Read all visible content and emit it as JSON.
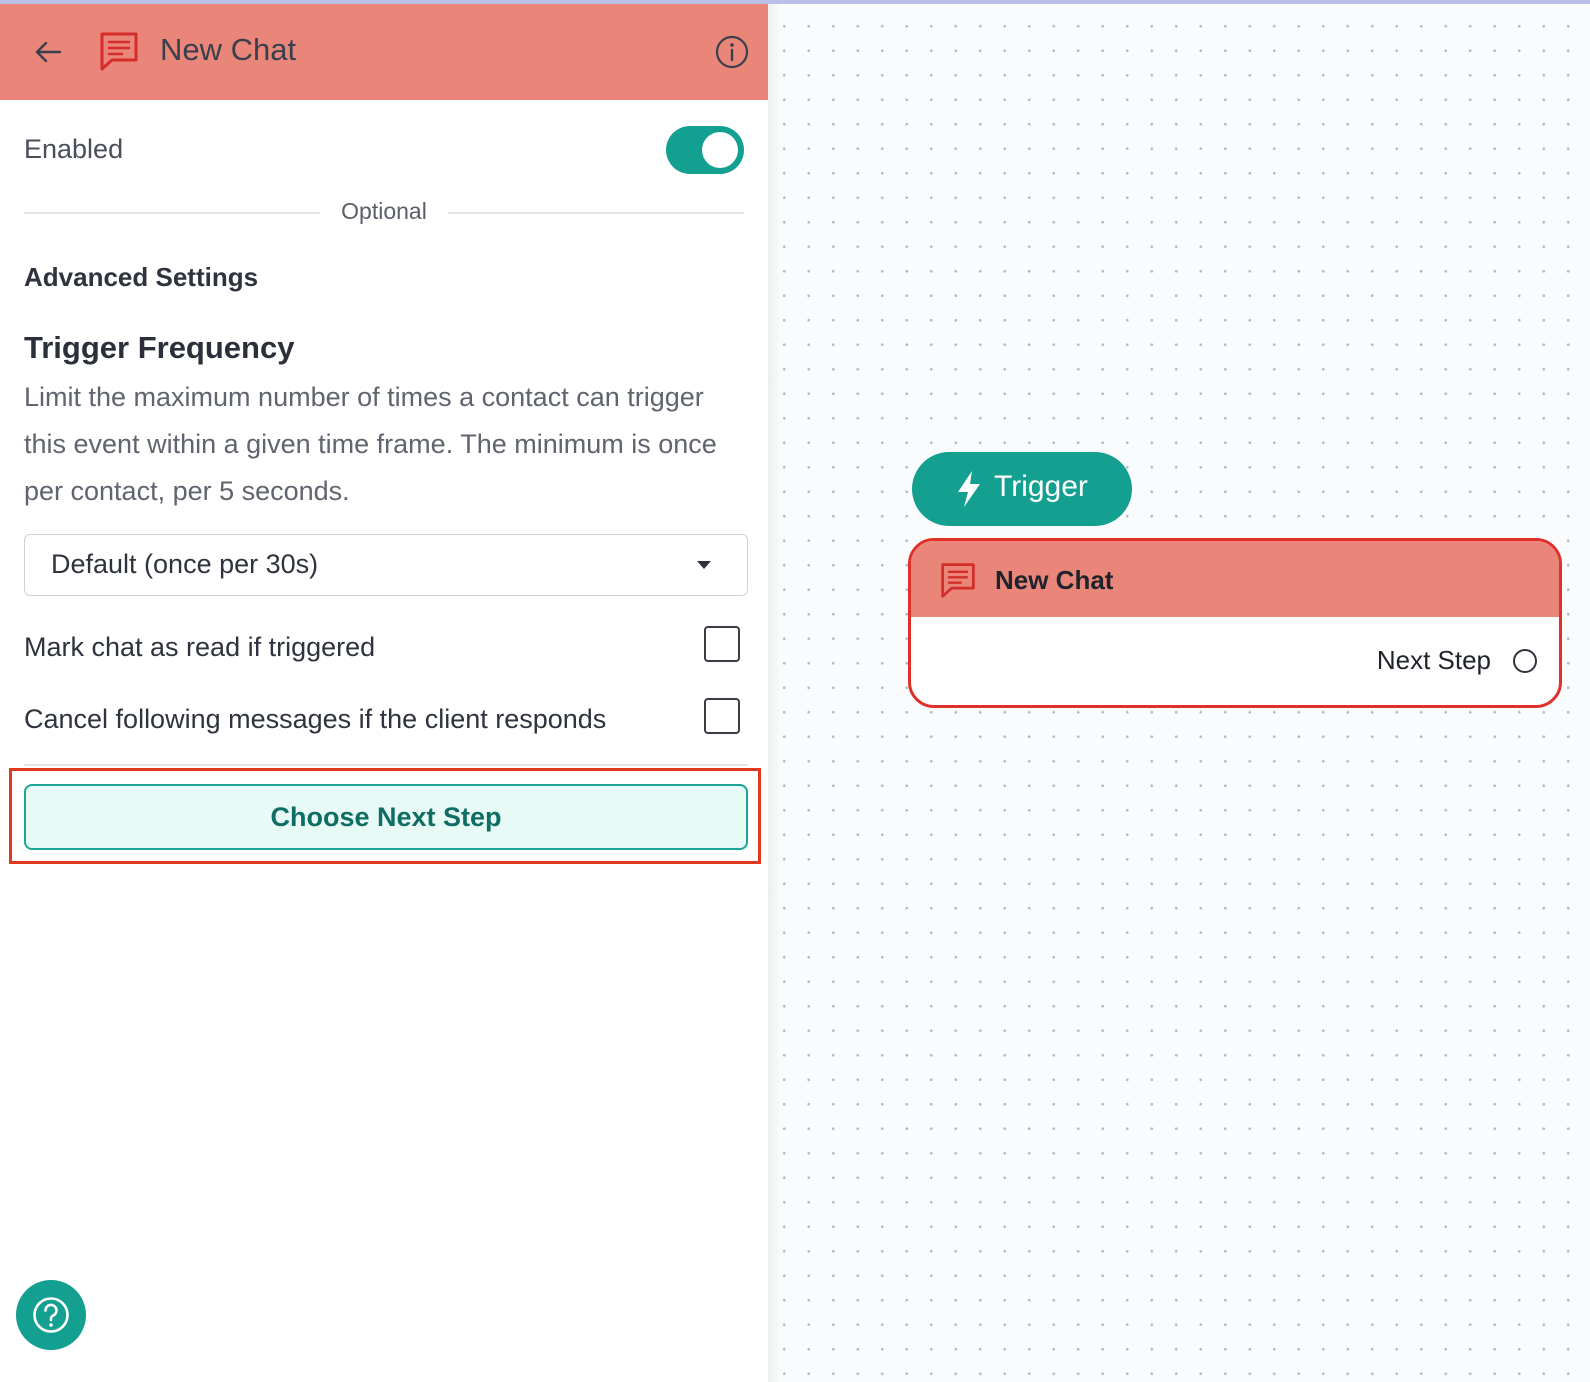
{
  "header": {
    "title": "New Chat"
  },
  "settings": {
    "enabled_label": "Enabled",
    "enabled": true,
    "optional_label": "Optional",
    "advanced_title": "Advanced Settings",
    "frequency_title": "Trigger Frequency",
    "frequency_description": "Limit the maximum number of times a contact can trigger this event within a given time frame. The minimum is once per contact, per 5 seconds.",
    "frequency_select_value": "Default (once per 30s)",
    "mark_read_label": "Mark chat as read if triggered",
    "mark_read_checked": false,
    "cancel_label": "Cancel following messages if the client responds",
    "cancel_checked": false,
    "choose_next_label": "Choose Next Step"
  },
  "canvas": {
    "trigger_label": "Trigger",
    "node_title": "New Chat",
    "node_output_label": "Next Step"
  },
  "colors": {
    "header": "#ea857a",
    "accent": "#14a090",
    "highlight": "#e23a1f",
    "node_border": "#e0302a"
  },
  "icons": [
    "back-arrow-icon",
    "chat-icon",
    "info-icon",
    "dropdown-caret-icon",
    "help-icon",
    "lightning-bolt-icon"
  ]
}
